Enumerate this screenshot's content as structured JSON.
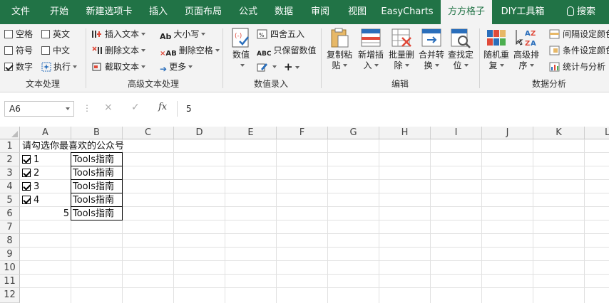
{
  "menu": {
    "tabs": [
      "文件",
      "开始",
      "新建选项卡",
      "插入",
      "页面布局",
      "公式",
      "数据",
      "审阅",
      "视图",
      "EasyCharts",
      "方方格子",
      "DIY工具箱"
    ],
    "active_tab": "方方格子",
    "search_label": "搜索"
  },
  "ribbon": {
    "text_processing": {
      "label": "文本处理",
      "checkboxes": [
        {
          "label": "空格",
          "checked": false
        },
        {
          "label": "英文",
          "checked": false
        },
        {
          "label": "符号",
          "checked": false
        },
        {
          "label": "中文",
          "checked": false
        },
        {
          "label": "数字",
          "checked": true
        }
      ],
      "execute_label": "执行"
    },
    "advanced_text": {
      "label": "高级文本处理",
      "insert_text": "插入文本",
      "delete_text": "删除文本",
      "cut_text": "截取文本",
      "case_label": "大小写",
      "delete_space": "删除空格",
      "more_label": "更多"
    },
    "numeric_entry": {
      "label": "数值录入",
      "value_button": "数值",
      "round_label": "四舍五入",
      "keep_values": "只保留数值"
    },
    "edit": {
      "label": "编辑",
      "buttons": [
        {
          "line1": "复制粘",
          "line2": "贴"
        },
        {
          "line1": "新增插",
          "line2": "入"
        },
        {
          "line1": "批量删",
          "line2": "除"
        },
        {
          "line1": "合并转",
          "line2": "换"
        },
        {
          "line1": "查找定",
          "line2": "位"
        }
      ]
    },
    "analysis": {
      "label": "数据分析",
      "random_line1": "随机重",
      "random_line2": "复",
      "sort_line1": "高级排",
      "sort_line2": "序",
      "interval_color": "间隔设定颜色",
      "cond_color": "条件设定颜色",
      "stats": "统计与分析"
    }
  },
  "formula_bar": {
    "name_box": "A6",
    "cancel_icon": "×",
    "enter_icon": "✓",
    "fx": "fx",
    "content": "5"
  },
  "sheet": {
    "columns": [
      "A",
      "B",
      "C",
      "D",
      "E",
      "F",
      "G",
      "H",
      "I",
      "J",
      "K",
      "L"
    ],
    "rows": [
      "1",
      "2",
      "3",
      "4",
      "5",
      "6",
      "7",
      "8",
      "9",
      "10",
      "11",
      "12"
    ],
    "a1_title": "请勾选你最喜欢的公众号",
    "options": [
      {
        "number": "1",
        "name": "Tools指南"
      },
      {
        "number": "2",
        "name": "Tools指南"
      },
      {
        "number": "3",
        "name": "Tools指南"
      },
      {
        "number": "4",
        "name": "Tools指南"
      }
    ],
    "a6_value": "5",
    "b6_value": "Tools指南"
  }
}
